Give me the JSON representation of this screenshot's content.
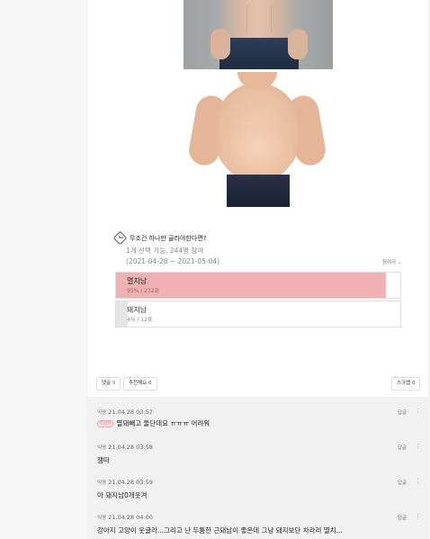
{
  "poll": {
    "title": "무조건 하나만 골라야한다면?",
    "info_line1": "1개 선택 가능, 244명 참여",
    "info_line2": "(2021-04-28 ~ 2021-05-04)",
    "voters_link": "참여자 ⌄",
    "options": [
      {
        "name": "멸치남",
        "count": "95% / 232표",
        "percent": 95,
        "selected": true
      },
      {
        "name": "돼지남",
        "count": "4% / 12표",
        "percent": 4,
        "selected": false
      }
    ]
  },
  "actions": {
    "comment_label": "댓글",
    "comment_count": "9",
    "recommend_label": "추천해요",
    "recommend_count": "0",
    "scrap_label": "스크랩",
    "scrap_count": "0"
  },
  "comments": [
    {
      "nick": "익명",
      "time": "21.04.28 03:57",
      "badge": "작성자",
      "text": "멸돼빼고 둘단데요 ㅠㅠㅠ 어려워",
      "reply": "답글"
    },
    {
      "nick": "익명",
      "time": "21.04.28 03:58",
      "badge": "",
      "text": "잼따",
      "reply": "답글"
    },
    {
      "nick": "익명",
      "time": "21.04.28 03:59",
      "badge": "",
      "text": "아 돼지남0개웃겨",
      "reply": "답글"
    },
    {
      "nick": "익명",
      "time": "21.04.28 04:00",
      "badge": "",
      "text": "강아지 고양이 웃글라...그리고 난 두툼한 근돼남이 좋은데 그냥 돼지보단 차라리 멸치...",
      "reply": "답글"
    }
  ],
  "icons": {
    "poll": "poll-check-icon",
    "more": "more-vertical-icon"
  },
  "colors": {
    "selected_fill": "#f1b1b2",
    "comment_count": "#e0524a"
  }
}
